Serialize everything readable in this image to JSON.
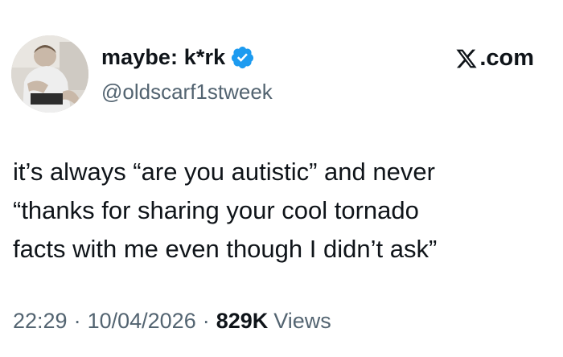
{
  "author": {
    "display_name": "maybe: k*rk",
    "handle": "@oldscarf1stweek",
    "verified": true,
    "verified_color": "#1d9bf0"
  },
  "source": {
    "label": ".com",
    "logo_icon": "x-logo-icon"
  },
  "tweet": {
    "lines": [
      "it’s always “are you autistic” and never",
      "“thanks for sharing your cool tornado",
      "facts with me even though I didn’t ask”"
    ]
  },
  "meta": {
    "time": "22:29",
    "separator": "·",
    "date": "10/04/2026",
    "views_count": "829K",
    "views_label": "Views"
  },
  "colors": {
    "text": "#0f1419",
    "secondary": "#536471",
    "accent": "#1d9bf0"
  }
}
